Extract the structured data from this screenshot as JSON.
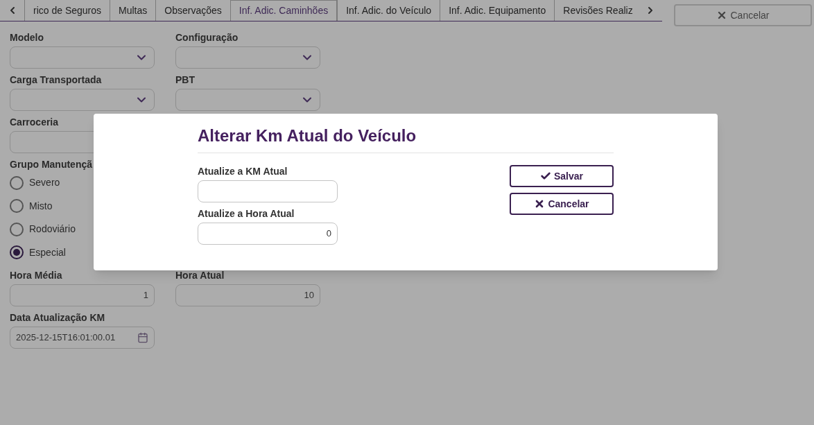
{
  "tabs": [
    {
      "label": "rico de Seguros",
      "selected": false
    },
    {
      "label": "Multas",
      "selected": false
    },
    {
      "label": "Observações",
      "selected": false
    },
    {
      "label": "Inf. Adic. Caminhões",
      "selected": true
    },
    {
      "label": "Inf. Adic. do Veículo",
      "selected": false
    },
    {
      "label": "Inf. Adic. Equipamento",
      "selected": false
    },
    {
      "label": "Revisões Realiz",
      "selected": false
    }
  ],
  "top_button": {
    "label": "Cancelar"
  },
  "form_rows": [
    {
      "fields": [
        {
          "label": "Modelo",
          "kind": "select"
        },
        {
          "label": "Configuração",
          "kind": "select"
        }
      ]
    },
    {
      "fields": [
        {
          "label": "Carga Transportada",
          "kind": "select"
        },
        {
          "label": "PBT",
          "kind": "select"
        }
      ]
    },
    {
      "fields": [
        {
          "label": "Carroceria",
          "kind": "text"
        }
      ]
    },
    {
      "radio_group": {
        "label": "Grupo Manutençã",
        "options": [
          {
            "label": "Severo",
            "selected": false
          },
          {
            "label": "Misto",
            "selected": false
          },
          {
            "label": "Rodoviário",
            "selected": false
          },
          {
            "label": "Especial",
            "selected": true
          }
        ]
      }
    },
    {
      "fields": [
        {
          "label": "Hora Média",
          "kind": "number",
          "value": "1"
        },
        {
          "label": "Hora Atual",
          "kind": "number",
          "value": "10"
        }
      ]
    },
    {
      "fields": [
        {
          "label": "Data Atualização KM",
          "kind": "date",
          "value": "2025-12-15T16:01:00.01"
        }
      ]
    }
  ],
  "dialog": {
    "title": "Alterar Km Atual do Veículo",
    "fields": [
      {
        "label": "Atualize a KM Atual"
      },
      {
        "label": "Atualize a Hora Atual",
        "value": "0"
      }
    ],
    "buttons": [
      {
        "label": "Salvar",
        "kind": "confirm"
      },
      {
        "label": "Cancelar",
        "kind": "cancel"
      }
    ]
  }
}
